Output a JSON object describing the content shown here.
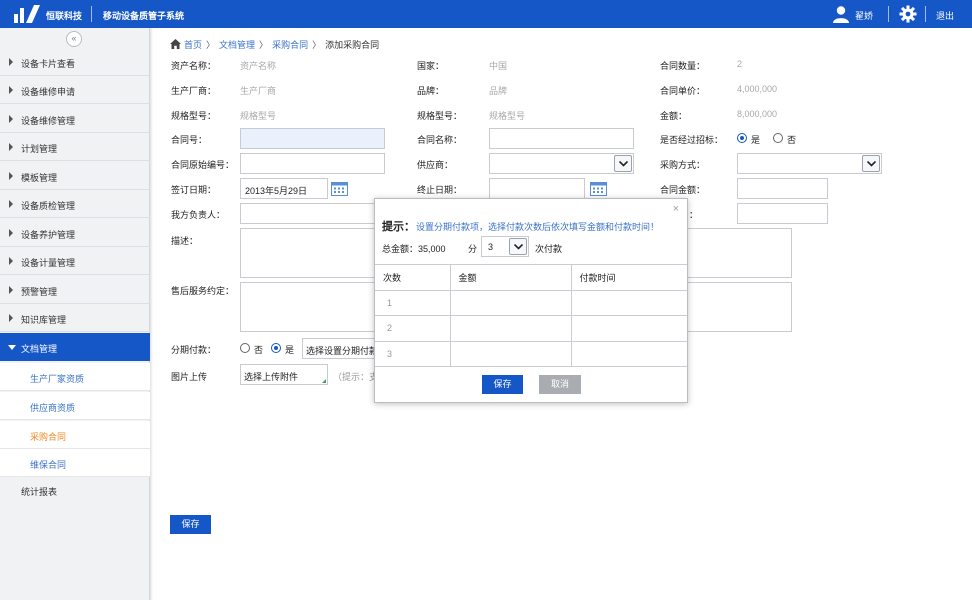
{
  "header": {
    "brand": "恒联科技",
    "system_title": "移动设备质管子系统",
    "user_name": "翟娇",
    "logout_label": "退出",
    "colors": {
      "primary": "#1557c7",
      "highlight": "#f08a24",
      "link": "#3a72c8"
    }
  },
  "sidebar": {
    "collapse_icon": "«",
    "items": [
      {
        "label": "设备卡片查看"
      },
      {
        "label": "设备维修申请"
      },
      {
        "label": "设备维修管理"
      },
      {
        "label": "计划管理"
      },
      {
        "label": "模板管理"
      },
      {
        "label": "设备质检管理"
      },
      {
        "label": "设备养护管理"
      },
      {
        "label": "设备计量管理"
      },
      {
        "label": "预警管理"
      },
      {
        "label": "知识库管理"
      },
      {
        "label": "文档管理",
        "active": true
      }
    ],
    "sub_items": [
      {
        "label": "生产厂家资质"
      },
      {
        "label": "供应商资质"
      },
      {
        "label": "采购合同",
        "current": true
      },
      {
        "label": "维保合同"
      }
    ],
    "last_item": {
      "label": "统计报表"
    }
  },
  "breadcrumb": {
    "home": "首页",
    "level1": "文档管理",
    "level2": "采购合同",
    "current": "添加采购合同",
    "separator": "〉"
  },
  "form": {
    "asset_name": {
      "label": "资产名称：",
      "value": "资产名称"
    },
    "country": {
      "label": "国家：",
      "value": "中国"
    },
    "contract_qty": {
      "label": "合同数量：",
      "value": "2"
    },
    "manufacturer": {
      "label": "生产厂商：",
      "value": "生产厂商"
    },
    "brand": {
      "label": "品牌：",
      "value": "品牌"
    },
    "unit_price": {
      "label": "合同单价：",
      "value": "4,000,000"
    },
    "model1": {
      "label": "规格型号：",
      "value": "规格型号"
    },
    "model2": {
      "label": "规格型号：",
      "value": "规格型号"
    },
    "amount": {
      "label": "金额：",
      "value": "8,000,000"
    },
    "contract_no": {
      "label": "合同号：",
      "value": ""
    },
    "contract_name": {
      "label": "合同名称：",
      "value": ""
    },
    "bidding": {
      "label": "是否经过招标：",
      "yes": "是",
      "no": "否",
      "selected": "是"
    },
    "original_no": {
      "label": "合同原始编号：",
      "value": ""
    },
    "supplier": {
      "label": "供应商：",
      "value": ""
    },
    "purchase_method": {
      "label": "采购方式：",
      "value": ""
    },
    "sign_date": {
      "label": "签订日期：",
      "value": "2013年5月29日"
    },
    "end_date": {
      "label": "终止日期：",
      "value": ""
    },
    "contract_amount": {
      "label": "合同金额：",
      "value": ""
    },
    "our_person": {
      "label": "我方负责人：",
      "value": ""
    },
    "other_field": {
      "label": "：",
      "value": ""
    },
    "description": {
      "label": "描述："
    },
    "after_sales": {
      "label": "售后服务约定："
    },
    "installment": {
      "label": "分期付款：",
      "no": "否",
      "yes": "是",
      "selected": "是",
      "button": "选择设置分期付款"
    },
    "image_upload": {
      "label": "图片上传",
      "button": "选择上传附件",
      "hint": "（提示：支"
    },
    "save_label": "保存"
  },
  "dialog": {
    "close_icon": "×",
    "tip_title": "提示：",
    "tip_text": "设置分期付款项，选择付款次数后依次填写金额和付款时间！",
    "total_label": "总金额：35,000",
    "fen_label": "分",
    "count_value": "3",
    "times_label": "次付款",
    "columns": [
      "次数",
      "金额",
      "付款时间"
    ],
    "rows": [
      {
        "idx": "1",
        "amount": "",
        "time": ""
      },
      {
        "idx": "2",
        "amount": "",
        "time": ""
      },
      {
        "idx": "3",
        "amount": "",
        "time": ""
      }
    ],
    "save_label": "保存",
    "cancel_label": "取消"
  }
}
